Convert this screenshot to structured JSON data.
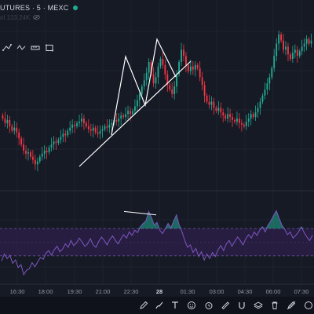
{
  "header": {
    "title": "UTURES · 5 · MEXC",
    "volume_text": "ol 133.24K",
    "live_color": "#22ab94"
  },
  "toolbar_icons": [
    "trend-line-icon",
    "multi-point-icon",
    "ruler-icon",
    "rectangle-icon"
  ],
  "time_axis": {
    "labels": [
      "16:30",
      "18:00",
      "19:30",
      "21:00",
      "22:30",
      "28",
      "01:30",
      "03:00",
      "04:30",
      "06:00",
      "07:30"
    ]
  },
  "bottom_toolbar": {
    "icons": [
      "pen-icon",
      "brush-icon",
      "text-icon",
      "emoji-icon",
      "alarm-icon",
      "ruler-icon",
      "layers-icon",
      "trash-icon",
      "magnet-icon",
      "expand-icon"
    ]
  },
  "colors": {
    "background": "#161a25",
    "up": "#22ab94",
    "down": "#f23645",
    "oscillator": "#7e57c2",
    "band_fill": "#2a1f47",
    "trendline": "#ffffff"
  },
  "chart_data": {
    "type": "candlestick",
    "title": "",
    "price_series": {
      "name": "",
      "close": [
        63,
        60,
        62,
        58,
        55,
        57,
        54,
        50,
        46,
        42,
        40,
        41,
        38,
        36,
        33,
        35,
        38,
        40,
        42,
        41,
        44,
        46,
        48,
        47,
        49,
        51,
        53,
        52,
        55,
        57,
        59,
        58,
        60,
        61,
        63,
        60,
        58,
        56,
        55,
        57,
        54,
        53,
        55,
        56,
        58,
        57,
        59,
        60,
        62,
        61,
        63,
        65,
        64,
        66,
        68,
        66,
        68,
        71,
        75,
        79,
        84,
        88,
        93,
        100,
        92,
        86,
        90,
        97,
        102,
        98,
        92,
        85,
        82,
        79,
        84,
        92,
        100,
        108,
        104,
        98,
        94,
        97,
        95,
        98,
        96,
        90,
        85,
        78,
        74,
        72,
        74,
        70,
        68,
        70,
        67,
        65,
        63,
        66,
        64,
        62,
        61,
        63,
        60,
        59,
        58,
        61,
        63,
        66,
        64,
        67,
        70,
        74,
        78,
        82,
        86,
        90,
        96,
        104,
        112,
        118,
        114,
        108,
        110,
        105,
        102,
        106,
        108,
        104,
        107,
        110,
        112,
        115,
        112,
        114
      ],
      "patterns": [
        {
          "type": "double-top",
          "peaks": [
            100,
            108
          ]
        },
        {
          "type": "support-trendline"
        }
      ]
    },
    "oscillator": {
      "name": "",
      "values": [
        -0.55,
        -0.35,
        -0.48,
        -0.38,
        -0.62,
        -0.52,
        -0.74,
        -0.66,
        -0.95,
        -0.82,
        -0.78,
        -0.6,
        -0.72,
        -0.58,
        -0.45,
        -0.5,
        -0.32,
        -0.25,
        -0.38,
        -0.22,
        -0.12,
        -0.28,
        -0.2,
        -0.05,
        -0.15,
        0.05,
        -0.1,
        -0.02,
        0.12,
        0.0,
        -0.12,
        -0.05,
        0.1,
        -0.08,
        -0.15,
        0.02,
        0.15,
        0.05,
        -0.08,
        0.08,
        0.18,
        0.05,
        -0.05,
        0.1,
        0.22,
        0.12,
        0.3,
        0.2,
        0.35,
        0.28,
        0.45,
        0.55,
        0.62,
        0.9,
        0.72,
        0.5,
        0.58,
        0.35,
        0.25,
        0.4,
        0.55,
        0.42,
        0.62,
        0.8,
        0.5,
        0.3,
        0.05,
        -0.15,
        -0.08,
        -0.3,
        -0.18,
        -0.42,
        -0.28,
        -0.52,
        -0.35,
        -0.48,
        -0.3,
        -0.42,
        -0.22,
        -0.1,
        -0.25,
        -0.05,
        0.05,
        -0.12,
        0.02,
        0.15,
        0.05,
        -0.08,
        0.1,
        0.22,
        0.12,
        0.3,
        0.2,
        0.35,
        0.45,
        0.3,
        0.5,
        0.62,
        0.78,
        0.92,
        0.7,
        0.5,
        0.38,
        0.22,
        0.3,
        0.12,
        0.2,
        0.3,
        0.45,
        0.28,
        0.15,
        0.05,
        0.2
      ],
      "upper_band": 0.4,
      "lower_band": -0.4,
      "range": [
        -1,
        1
      ],
      "divergence_line": true
    }
  }
}
